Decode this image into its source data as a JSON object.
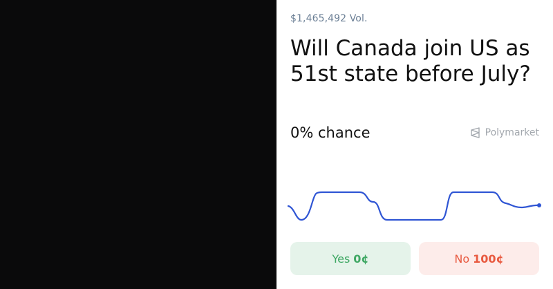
{
  "market": {
    "volume": "$1,465,492 Vol.",
    "question": "Will Canada join US as 51st state before July?",
    "chance": "0% chance",
    "brand": "Polymarket",
    "brand_icon": "polymarket-logo-icon",
    "sparkline_color": "#2f55d4"
  },
  "buttons": {
    "yes_label": "Yes",
    "yes_price": "0¢",
    "no_label": "No",
    "no_price": "100¢"
  },
  "colors": {
    "yes": "#3fa864",
    "no": "#e8593f",
    "background_dark": "#0a0a0b"
  }
}
